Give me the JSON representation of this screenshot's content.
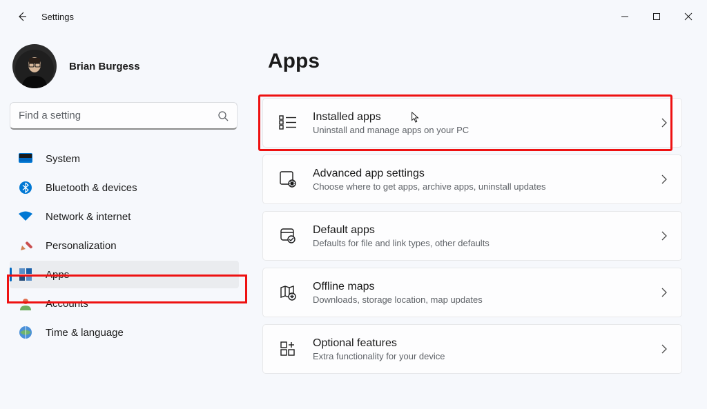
{
  "window": {
    "app_title": "Settings"
  },
  "profile": {
    "name": "Brian Burgess"
  },
  "search": {
    "placeholder": "Find a setting",
    "value": ""
  },
  "sidebar": {
    "items": [
      {
        "label": "System",
        "icon": "system"
      },
      {
        "label": "Bluetooth & devices",
        "icon": "bluetooth"
      },
      {
        "label": "Network & internet",
        "icon": "wifi"
      },
      {
        "label": "Personalization",
        "icon": "personalization"
      },
      {
        "label": "Apps",
        "icon": "apps",
        "active": true
      },
      {
        "label": "Accounts",
        "icon": "accounts"
      },
      {
        "label": "Time & language",
        "icon": "time"
      }
    ]
  },
  "page": {
    "title": "Apps"
  },
  "cards": [
    {
      "title": "Installed apps",
      "sub": "Uninstall and manage apps on your PC",
      "icon": "installed"
    },
    {
      "title": "Advanced app settings",
      "sub": "Choose where to get apps, archive apps, uninstall updates",
      "icon": "advanced"
    },
    {
      "title": "Default apps",
      "sub": "Defaults for file and link types, other defaults",
      "icon": "defaults"
    },
    {
      "title": "Offline maps",
      "sub": "Downloads, storage location, map updates",
      "icon": "maps"
    },
    {
      "title": "Optional features",
      "sub": "Extra functionality for your device",
      "icon": "optional"
    }
  ]
}
